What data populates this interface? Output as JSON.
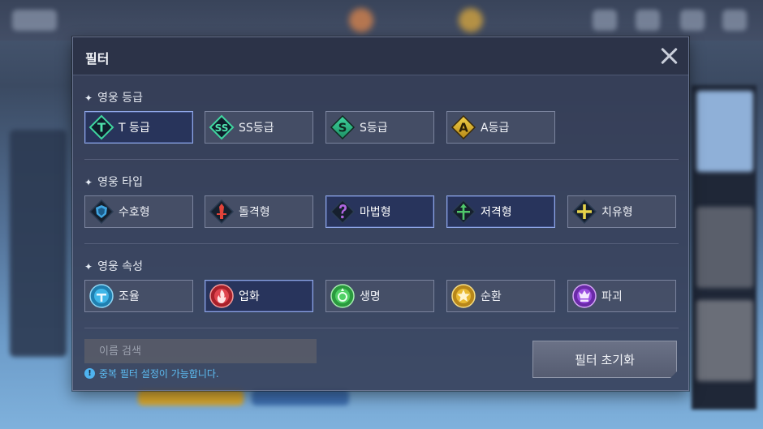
{
  "modal": {
    "title": "필터",
    "close_icon": "close-icon"
  },
  "sections": {
    "grade": {
      "title": "영웅 등급",
      "options": [
        {
          "label": "T 등급",
          "icon": "grade-t-icon",
          "badge": "T",
          "selected": true
        },
        {
          "label": "SS등급",
          "icon": "grade-ss-icon",
          "badge": "SS",
          "selected": false
        },
        {
          "label": "S등급",
          "icon": "grade-s-icon",
          "badge": "S",
          "selected": false
        },
        {
          "label": "A등급",
          "icon": "grade-a-icon",
          "badge": "A",
          "selected": false
        }
      ]
    },
    "type": {
      "title": "영웅 타입",
      "options": [
        {
          "label": "수호형",
          "icon": "guardian-shield-icon",
          "selected": false
        },
        {
          "label": "돌격형",
          "icon": "assault-sword-icon",
          "selected": false
        },
        {
          "label": "마법형",
          "icon": "magic-question-icon",
          "selected": true
        },
        {
          "label": "저격형",
          "icon": "sniper-arrow-icon",
          "selected": true
        },
        {
          "label": "치유형",
          "icon": "healer-cross-icon",
          "selected": false
        }
      ]
    },
    "attribute": {
      "title": "영웅 속성",
      "options": [
        {
          "label": "조율",
          "icon": "harmony-element-icon",
          "selected": false
        },
        {
          "label": "업화",
          "icon": "hellfire-element-icon",
          "selected": true
        },
        {
          "label": "생명",
          "icon": "life-element-icon",
          "selected": false
        },
        {
          "label": "순환",
          "icon": "cycle-element-icon",
          "selected": false
        },
        {
          "label": "파괴",
          "icon": "destruction-element-icon",
          "selected": false
        }
      ]
    }
  },
  "search": {
    "placeholder": "이름 검색",
    "value": ""
  },
  "hint": {
    "text": "중복 필터 설정이 가능합니다.",
    "icon": "info-icon"
  },
  "reset_button": {
    "label": "필터 초기화"
  },
  "colors": {
    "selected_border": "#8fa6e6",
    "selected_bg": "#27345c",
    "grade_badge": "#2ea878",
    "grade_a_badge": "#c9a227",
    "hint": "#5dbdf3"
  }
}
